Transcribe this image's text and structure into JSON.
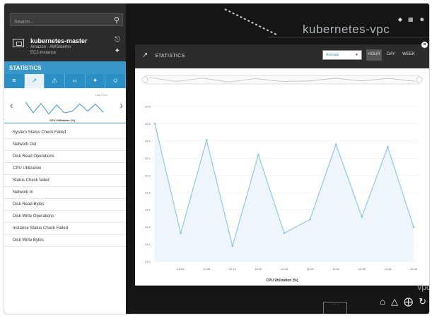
{
  "search": {
    "placeholder": "Search..."
  },
  "node": {
    "title": "kubernetes-master",
    "subtitle": "Amazon - AWS/demo",
    "type": "EC2-Instance"
  },
  "statistics_header": "STATISTICS",
  "left_tabs": [
    "≡",
    "↗",
    "⚠",
    "‹‹",
    "✦",
    "☺"
  ],
  "sparkline": {
    "last_label": "Last Hour",
    "caption": "CPU Utilization (%)"
  },
  "metrics": [
    "System Status Check Failed",
    "Network Out",
    "Disk Read Operations",
    "CPU Utilization",
    "Status Check failed",
    "Network In",
    "Disk Read Bytes",
    "Disk Write Operations",
    "Instance Status Check Failed",
    "Disk Write Bytes"
  ],
  "canvas": {
    "vpc_title": "kubernetes-vpc",
    "vpc_short": "vpc"
  },
  "modal": {
    "title": "STATISTICS",
    "aggregate": "Average",
    "ranges": [
      "HOUR",
      "DAY",
      "WEEK"
    ],
    "active_range": "HOUR"
  },
  "colors": {
    "accent": "#3a97c9",
    "series": "#8fc8e8",
    "fill": "#eef6fb"
  },
  "chart_data": {
    "type": "area",
    "xlabel": "CPU Utilization (%)",
    "ylabel": "",
    "x": [
      "12:03",
      "12:04",
      "12:09",
      "12:14",
      "12:19",
      "12:24",
      "12:29",
      "12:34",
      "12:39",
      "12:44",
      "12:49"
    ],
    "x_ticks": [
      "12:04",
      "12:09",
      "12:14",
      "12:19",
      "12:24",
      "12:29",
      "12:34",
      "12:39",
      "12:44",
      "12:49"
    ],
    "y_ticks": [
      31.0,
      31.2,
      31.4,
      31.6,
      31.8,
      32.0,
      32.2,
      32.4,
      32.6,
      32.8
    ],
    "ylim": [
      31.0,
      32.8
    ],
    "series": [
      {
        "values": [
          32.6,
          31.33,
          32.41,
          31.18,
          32.24,
          31.33,
          31.49,
          32.36,
          31.52,
          32.33,
          31.4
        ]
      }
    ],
    "grid": true
  }
}
